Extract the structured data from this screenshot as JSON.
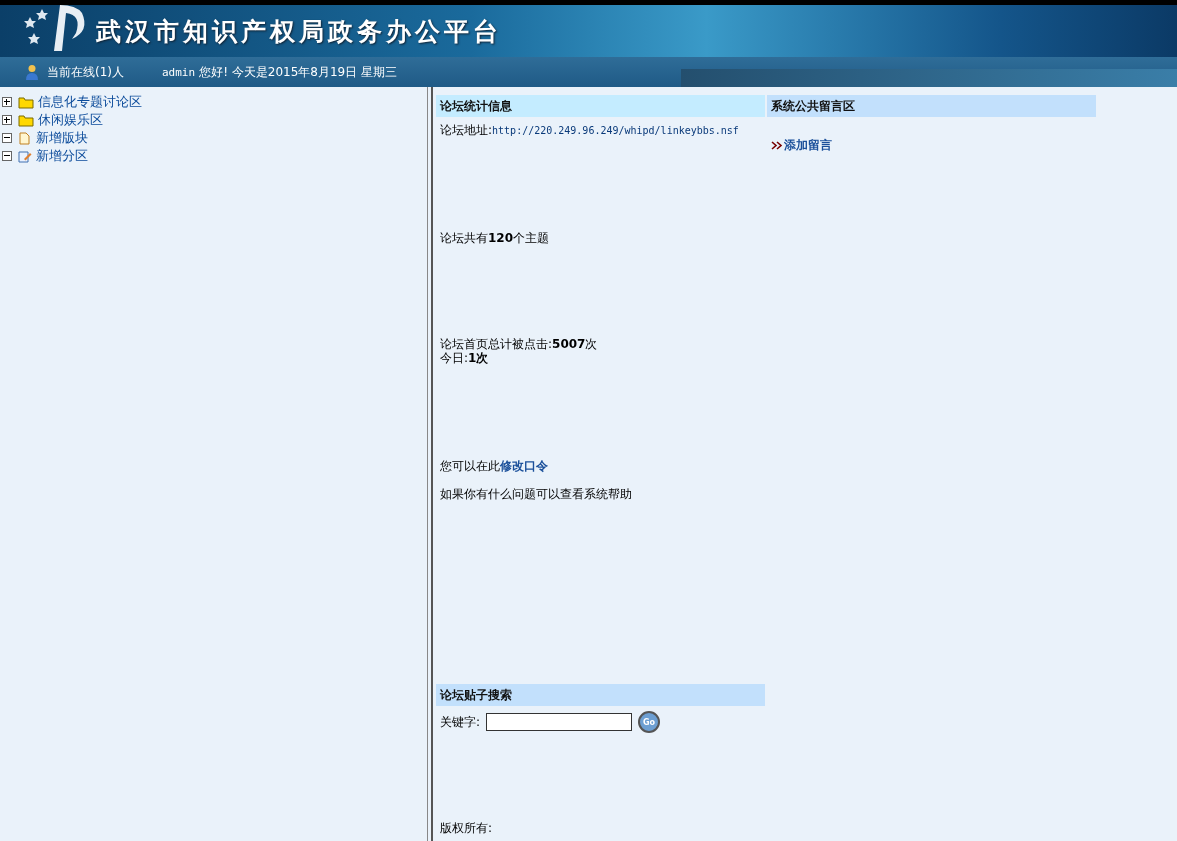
{
  "header": {
    "title": "武汉市知识产权局政务办公平台",
    "online": "当前在线(1)人",
    "user": "admin",
    "greeting": "您好! 今天是2015年8月19日  星期三"
  },
  "tree": [
    {
      "label": "信息化专题讨论区",
      "kind": "folder",
      "expanded": false
    },
    {
      "label": "休闲娱乐区",
      "kind": "folder",
      "expanded": false
    },
    {
      "label": "新增版块",
      "kind": "page",
      "expanded": true
    },
    {
      "label": "新增分区",
      "kind": "edit",
      "expanded": true
    }
  ],
  "stats": {
    "title": "论坛统计信息",
    "address_label": "论坛地址:",
    "address": "http://220.249.96.249/whipd/linkeybbs.nsf",
    "topics": "论坛共有**120**个主题",
    "clicks": "论坛首页总计被点击:**5007**次",
    "today": "今日:**1次**",
    "password_text": "您可以在此",
    "password_link": "修改口令",
    "help": "如果你有什么问题可以查看系统帮助"
  },
  "messages": {
    "title": "系统公共留言区",
    "add_link": "添加留言"
  },
  "search": {
    "title": "论坛贴子搜索",
    "keyword_label": "关键字:",
    "button": "Go"
  },
  "footer": {
    "copyright": "版权所有:"
  }
}
